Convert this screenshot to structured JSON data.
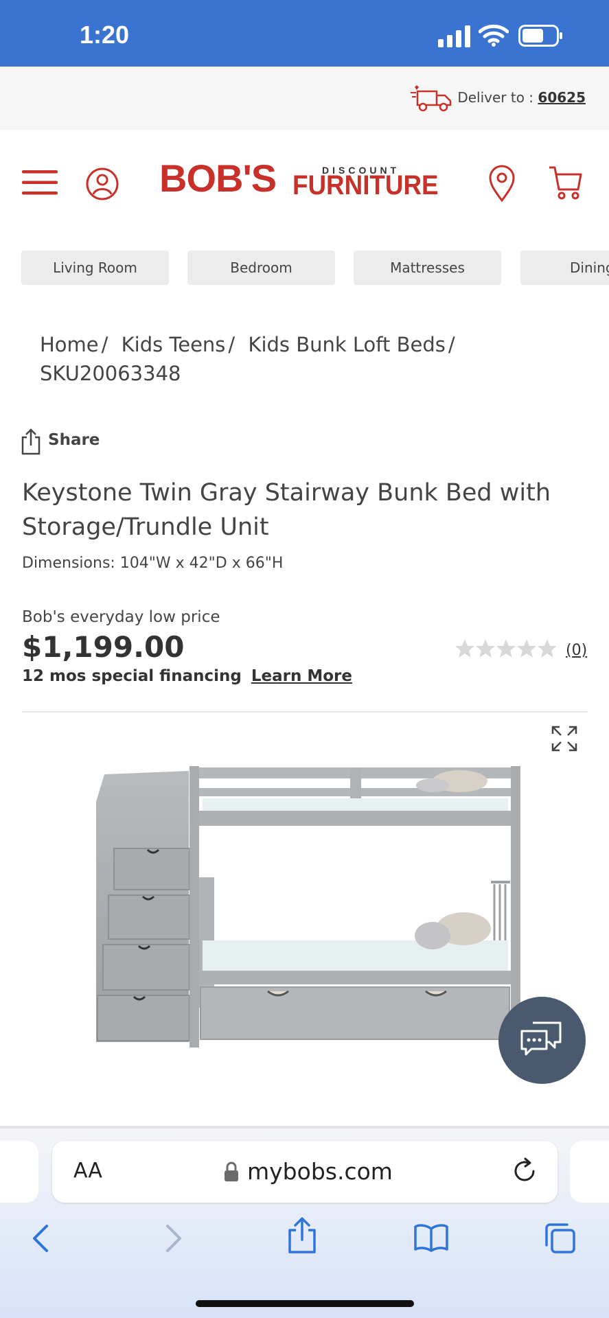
{
  "status_bar": {
    "time": "1:20"
  },
  "delivery": {
    "label": "Deliver to :",
    "zip": "60625"
  },
  "header": {
    "logo_main": "BOB'S",
    "logo_discount": "DISCOUNT",
    "logo_furniture": "FURNITURE"
  },
  "categories": [
    "Living Room",
    "Bedroom",
    "Mattresses",
    "Dining"
  ],
  "breadcrumb": {
    "items": [
      "Home",
      "Kids Teens",
      "Kids Bunk Loft Beds",
      "SKU20063348"
    ],
    "separator": "/"
  },
  "product": {
    "share_label": "Share",
    "title": "Keystone Twin Gray Stairway Bunk Bed with Storage/Trundle Unit",
    "dimensions": "Dimensions: 104\"W x 42\"D x 66\"H",
    "price_label": "Bob's everyday low price",
    "price": "$1,199.00",
    "financing": "12 mos special financing",
    "learn_more": "Learn More",
    "rating_stars": 0,
    "review_count": "(0)"
  },
  "browser": {
    "aa_label": "AA",
    "url": "mybobs.com"
  },
  "colors": {
    "status_bar": "#3a74d0",
    "brand_red": "#c8312a",
    "chat_button": "#4a5a6e"
  }
}
